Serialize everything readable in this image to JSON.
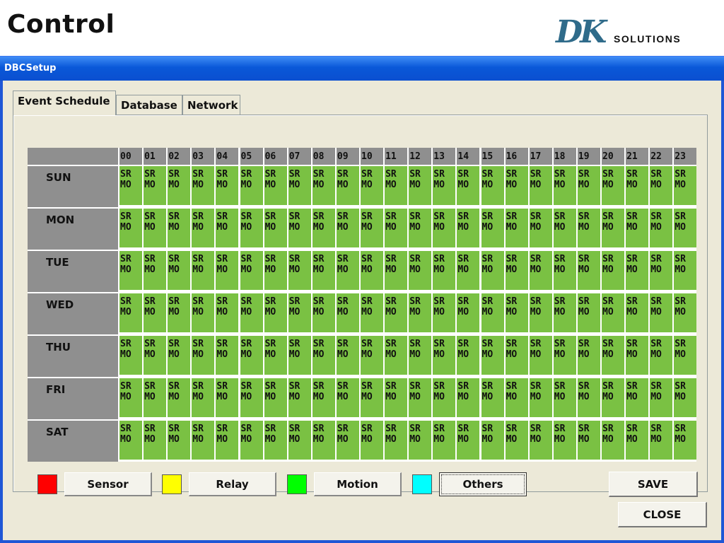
{
  "slide": {
    "title": "Control",
    "logo_mark": "DK",
    "logo_text": "SOLUTIONS"
  },
  "window": {
    "title": "DBCSetup"
  },
  "tabs": [
    {
      "label": "Event Schedule",
      "active": true
    },
    {
      "label": "Database",
      "active": false
    },
    {
      "label": "Network",
      "active": false
    }
  ],
  "schedule": {
    "hours": [
      "00",
      "01",
      "02",
      "03",
      "04",
      "05",
      "06",
      "07",
      "08",
      "09",
      "10",
      "11",
      "12",
      "13",
      "14",
      "15",
      "16",
      "17",
      "18",
      "19",
      "20",
      "21",
      "22",
      "23"
    ],
    "days": [
      "SUN",
      "MON",
      "TUE",
      "WED",
      "THU",
      "FRI",
      "SAT"
    ],
    "cell_line1": "SR",
    "cell_line2": "MO",
    "cell_color": "#7ac143",
    "header_color": "#8f8f8f"
  },
  "legend": [
    {
      "label": "Sensor",
      "color": "#ff0000"
    },
    {
      "label": "Relay",
      "color": "#ffff00"
    },
    {
      "label": "Motion",
      "color": "#00ff00"
    },
    {
      "label": "Others",
      "color": "#00ffff"
    }
  ],
  "buttons": {
    "save": "SAVE",
    "close": "CLOSE"
  }
}
